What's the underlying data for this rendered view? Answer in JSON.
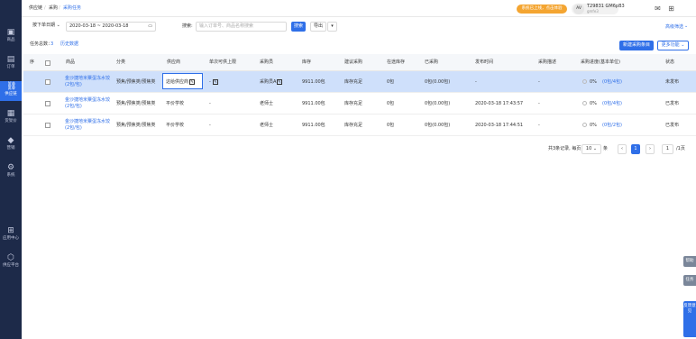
{
  "sidebar": {
    "items": [
      {
        "label": "商品",
        "icon": "box-icon"
      },
      {
        "label": "订单",
        "icon": "document-icon"
      },
      {
        "label": "供应链",
        "icon": "link-icon"
      },
      {
        "label": "货架价",
        "icon": "shelf-icon"
      },
      {
        "label": "营销",
        "icon": "tag-icon"
      },
      {
        "label": "系统",
        "icon": "gear-icon"
      },
      {
        "label": "应用中心",
        "icon": "apps-icon"
      },
      {
        "label": "供应平台",
        "icon": "platform-icon"
      }
    ]
  },
  "header": {
    "breadcrumb": [
      "供应链",
      "采购",
      "采购任务"
    ],
    "banner": "系统已上线，点击体验",
    "avatar": "AV",
    "user_name": "T29831 GM6pB3",
    "user_sub": "gmfe3"
  },
  "filters": {
    "date_type": "按下单日期",
    "date_range": "2020-03-18 ~ 2020-03-18",
    "search_label": "搜索:",
    "search_placeholder": "输入订单号、商品名称搜索",
    "search_button": "搜索",
    "export_button": "导出",
    "more_button": "▾",
    "advanced": "高级筛选"
  },
  "toolbar": {
    "task_count_label": "任务总数：",
    "task_count": "3",
    "history_link": "历史数据",
    "new_button": "新建采购条目",
    "more_button": "更多功能"
  },
  "table": {
    "columns": [
      "序",
      "商品",
      "分类",
      "供应商",
      "单次可供上限",
      "采购员",
      "库存",
      "建议采购",
      "在途库存",
      "已采购",
      "发布时间",
      "采购描述",
      "采购进度(基本单位)",
      "状态"
    ],
    "rows": [
      {
        "product": "金沙捷地米粟蛋冻水饺(2包/包)",
        "category": "预焦/预焦类/预焦类",
        "supplier": "这给供应商",
        "limit": "-",
        "buyer": "采购员A",
        "stock": "9911.00包",
        "suggest": "库存充足",
        "in_transit": "0包",
        "purchased": "0包(0.00包)",
        "publish_time": "-",
        "desc": "-",
        "progress": "0%",
        "progress_detail": "(0包/4包)",
        "status": "未发布"
      },
      {
        "product": "金沙捷地米粟蛋冻水饺(2包/包)",
        "category": "预焦/预焦类/预焦类",
        "supplier": "平价学校",
        "limit": "-",
        "buyer": "老师士",
        "stock": "9911.00包",
        "suggest": "库存充足",
        "in_transit": "0包",
        "purchased": "0包(0.00包)",
        "publish_time": "2020-03-18 17:43:57",
        "desc": "-",
        "progress": "0%",
        "progress_detail": "(0包/4包)",
        "status": "已发布"
      },
      {
        "product": "金沙捷地米粟蛋冻水饺(2包/包)",
        "category": "预焦/预焦类/预焦类",
        "supplier": "平价学校",
        "limit": "-",
        "buyer": "老师士",
        "stock": "9911.00包",
        "suggest": "库存充足",
        "in_transit": "0包",
        "purchased": "0包(0.00包)",
        "publish_time": "2020-03-18 17:44:51",
        "desc": "-",
        "progress": "0%",
        "progress_detail": "(0包/2包)",
        "status": "已发布"
      }
    ]
  },
  "pager": {
    "summary": "共3条记录, 每页",
    "page_size": "10",
    "unit": "条",
    "prev": "‹",
    "current": "1",
    "next": "›",
    "jump_value": "1",
    "jump_label": "/1页"
  },
  "floating": {
    "tab1": "帮助",
    "tab2": "任务",
    "tab3": "反馈意见"
  },
  "colors": {
    "accent": "#2f6fe8",
    "sidebar": "#1d2a49",
    "banner": "#f4a531"
  }
}
